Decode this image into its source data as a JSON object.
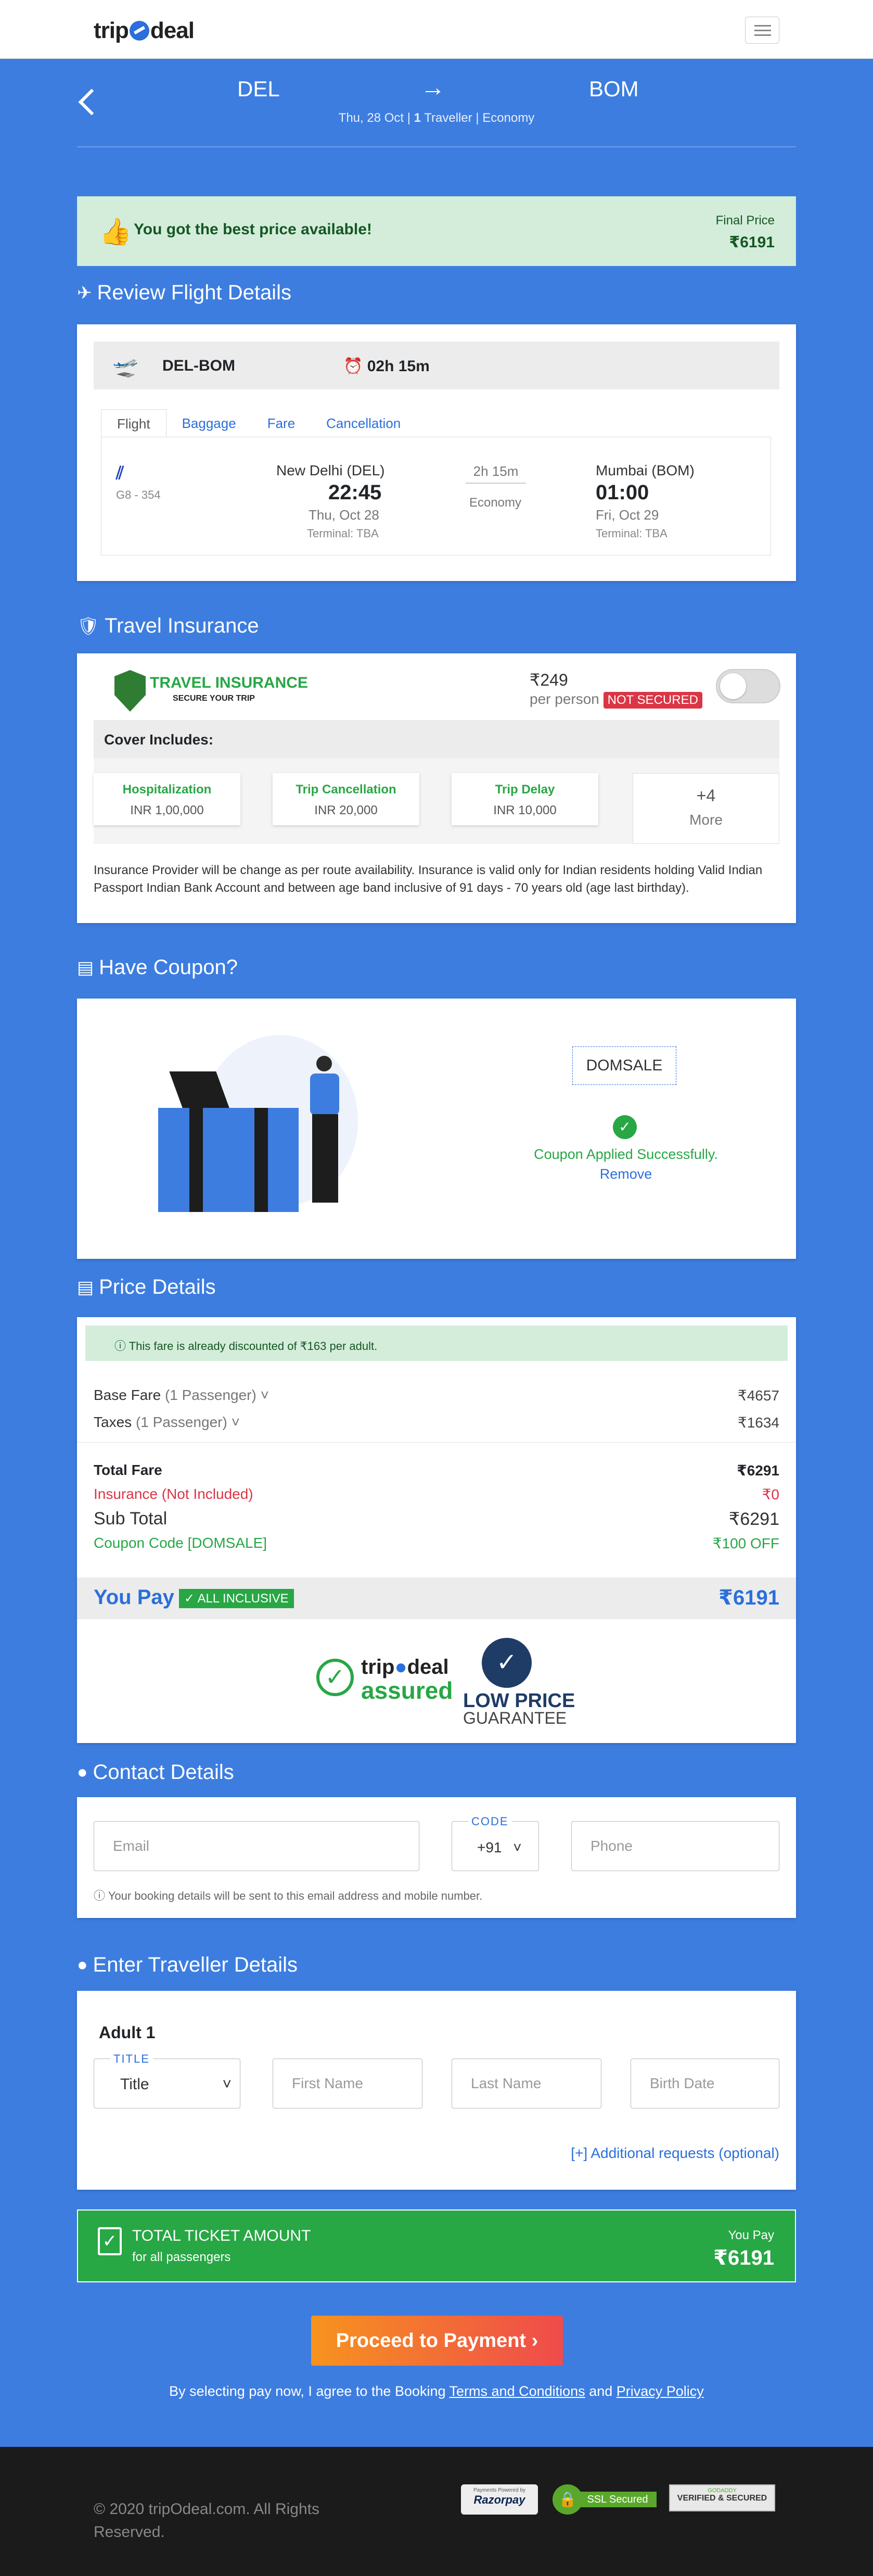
{
  "header": {
    "logo_left": "trip",
    "logo_right": "deal",
    "menu_icon": "hamburger-icon"
  },
  "route": {
    "from": "DEL",
    "to": "BOM",
    "date": "Thu, 28 Oct",
    "travellers_num": "1",
    "travellers_rest": "Traveller | Economy"
  },
  "banner": {
    "message": "You got the best price available!",
    "final_price_label": "Final Price",
    "final_price": "₹6191"
  },
  "review": {
    "title": "Review Flight Details",
    "route_code": "DEL-BOM",
    "duration": "02h 15m",
    "tabs": [
      "Flight",
      "Baggage",
      "Fare",
      "Cancellation"
    ],
    "flight_no": "G8 - 354",
    "dep_city": "New Delhi (DEL)",
    "dep_time": "22:45",
    "dep_date": "Thu, Oct 28",
    "dep_terminal": "Terminal: TBA",
    "stop_duration": "2h 15m",
    "cabin": "Economy",
    "arr_city": "Mumbai (BOM)",
    "arr_time": "01:00",
    "arr_date": "Fri, Oct 29",
    "arr_terminal": "Terminal: TBA"
  },
  "insurance": {
    "title": "Travel Insurance",
    "brand": "TRAVEL INSURANCE",
    "brand_sub": "SECURE YOUR TRIP",
    "price": "₹249",
    "per": "per person",
    "status": "NOT SECURED",
    "cover_label": "Cover Includes:",
    "covers": [
      {
        "title": "Hospitalization",
        "value": "INR 1,00,000"
      },
      {
        "title": "Trip Cancellation",
        "value": "INR 20,000"
      },
      {
        "title": "Trip Delay",
        "value": "INR 10,000"
      }
    ],
    "more_count": "+4",
    "more_label": "More",
    "note": "Insurance Provider will be change as per route availability. Insurance is valid only for Indian residents holding Valid Indian Passport Indian Bank Account and between age band inclusive of 91 days - 70 years old (age last birthday)."
  },
  "coupon": {
    "title": "Have Coupon?",
    "code": "DOMSALE",
    "success": "Coupon Applied Successfully.",
    "remove": "Remove"
  },
  "price": {
    "title": "Price Details",
    "discount_note": "This fare is already discounted of ₹163 per adult.",
    "base_label": "Base Fare",
    "base_pax": "(1 Passenger)",
    "base_val": "₹4657",
    "tax_label": "Taxes",
    "tax_pax": "(1 Passenger)",
    "tax_val": "₹1634",
    "total_label": "Total Fare",
    "total_val": "₹6291",
    "ins_label": "Insurance (Not Included)",
    "ins_val": "₹0",
    "sub_label": "Sub Total",
    "sub_val": "₹6291",
    "coupon_label": "Coupon Code [DOMSALE]",
    "coupon_val": "₹100 OFF",
    "pay_label": "You Pay",
    "pay_badge": "ALL INCLUSIVE",
    "pay_val": "₹6191",
    "assured_top_a": "trip",
    "assured_top_b": "deal",
    "assured_bottom": "assured",
    "low_price": "LOW PRICE",
    "guarantee": "GUARANTEE"
  },
  "contact": {
    "title": "Contact Details",
    "email_placeholder": "Email",
    "code_label": "CODE",
    "code_value": "+91",
    "phone_placeholder": "Phone",
    "note": "Your booking details will be sent to this email address and mobile number."
  },
  "traveller": {
    "title": "Enter Traveller Details",
    "adult": "Adult 1",
    "title_label": "TITLE",
    "title_value": "Title",
    "first_name": "First Name",
    "last_name": "Last Name",
    "birth_date": "Birth Date",
    "additional": "[+] Additional requests (optional)"
  },
  "total": {
    "title": "TOTAL TICKET AMOUNT",
    "sub": "for all passengers",
    "pay_label": "You Pay",
    "pay_val": "₹6191"
  },
  "proceed": {
    "label": "Proceed to Payment",
    "agree_a": "By selecting pay now, I agree to the Booking",
    "terms": "Terms and Conditions",
    "and": "and",
    "privacy": "Privacy Policy"
  },
  "footer": {
    "copyright": "© 2020 tripOdeal.com. All Rights Reserved.",
    "razorpay_top": "Payments Powered by",
    "razorpay": "Razorpay",
    "ssl": "SSL Secured",
    "verified_top": "GODADDY",
    "verified": "VERIFIED & SECURED"
  }
}
